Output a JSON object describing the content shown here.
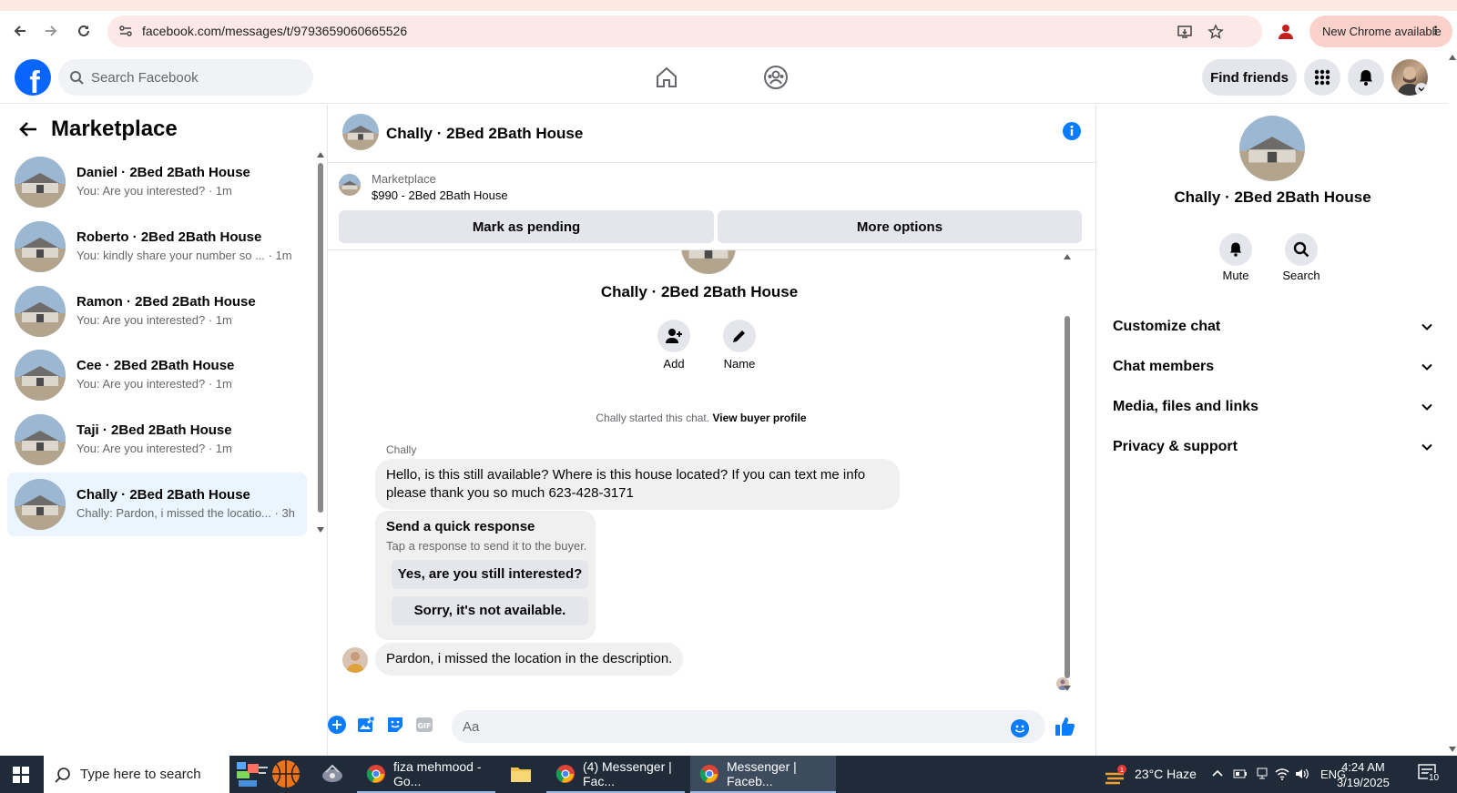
{
  "browser": {
    "url": "facebook.com/messages/t/9793659060665526",
    "new_chrome": "New Chrome available"
  },
  "header": {
    "search_placeholder": "Search Facebook",
    "find_friends": "Find friends"
  },
  "sidebar": {
    "title": "Marketplace",
    "conversations": [
      {
        "name": "Daniel · 2Bed 2Bath House",
        "preview": "You: Are you interested?",
        "time": "· 1m"
      },
      {
        "name": "Roberto · 2Bed 2Bath House",
        "preview": "You: kindly share your number so ...",
        "time": "· 1m"
      },
      {
        "name": "Ramon · 2Bed 2Bath House",
        "preview": "You: Are you interested?",
        "time": "· 1m"
      },
      {
        "name": "Cee · 2Bed 2Bath House",
        "preview": "You: Are you interested?",
        "time": "· 1m"
      },
      {
        "name": "Taji · 2Bed 2Bath House",
        "preview": "You: Are you interested?",
        "time": "· 1m"
      },
      {
        "name": "Chally · 2Bed 2Bath House",
        "preview": "Chally: Pardon, i missed the locatio...",
        "time": "· 3h"
      }
    ]
  },
  "chat": {
    "title": "Chally · 2Bed 2Bath House",
    "listing": {
      "source": "Marketplace",
      "detail": "$990 - 2Bed 2Bath House",
      "mark_pending": "Mark as pending",
      "more_options": "More options"
    },
    "intro": {
      "name": "Chally · 2Bed 2Bath House",
      "add": "Add",
      "name_btn": "Name",
      "started": "Chally started this chat.",
      "view_profile": "View buyer profile"
    },
    "sender": "Chally",
    "message1": "Hello, is this still available? Where is this house located? If you can text me info please thank you so much 623-428-3171",
    "quick": {
      "title": "Send a quick response",
      "subtitle": "Tap a response to send it to the buyer.",
      "option1": "Yes, are you still interested?",
      "option2": "Sorry, it's not available."
    },
    "message2": "Pardon, i missed the location in the description.",
    "composer_placeholder": "Aa"
  },
  "right_panel": {
    "name": "Chally · 2Bed 2Bath House",
    "mute": "Mute",
    "search": "Search",
    "sections": [
      "Customize chat",
      "Chat members",
      "Media, files and links",
      "Privacy & support"
    ]
  },
  "taskbar": {
    "search": "Type here to search",
    "apps": [
      "fiza mehmood - Go...",
      "(4) Messenger | Fac...",
      "Messenger | Faceb..."
    ],
    "weather": "23°C  Haze",
    "lang": "ENG",
    "time": "4:24 AM",
    "date": "3/19/2025",
    "notif_count": "10"
  },
  "colors": {
    "fb_blue": "#0866ff",
    "messenger_blue": "#0a7cff",
    "active_row": "#ebf5ff"
  }
}
